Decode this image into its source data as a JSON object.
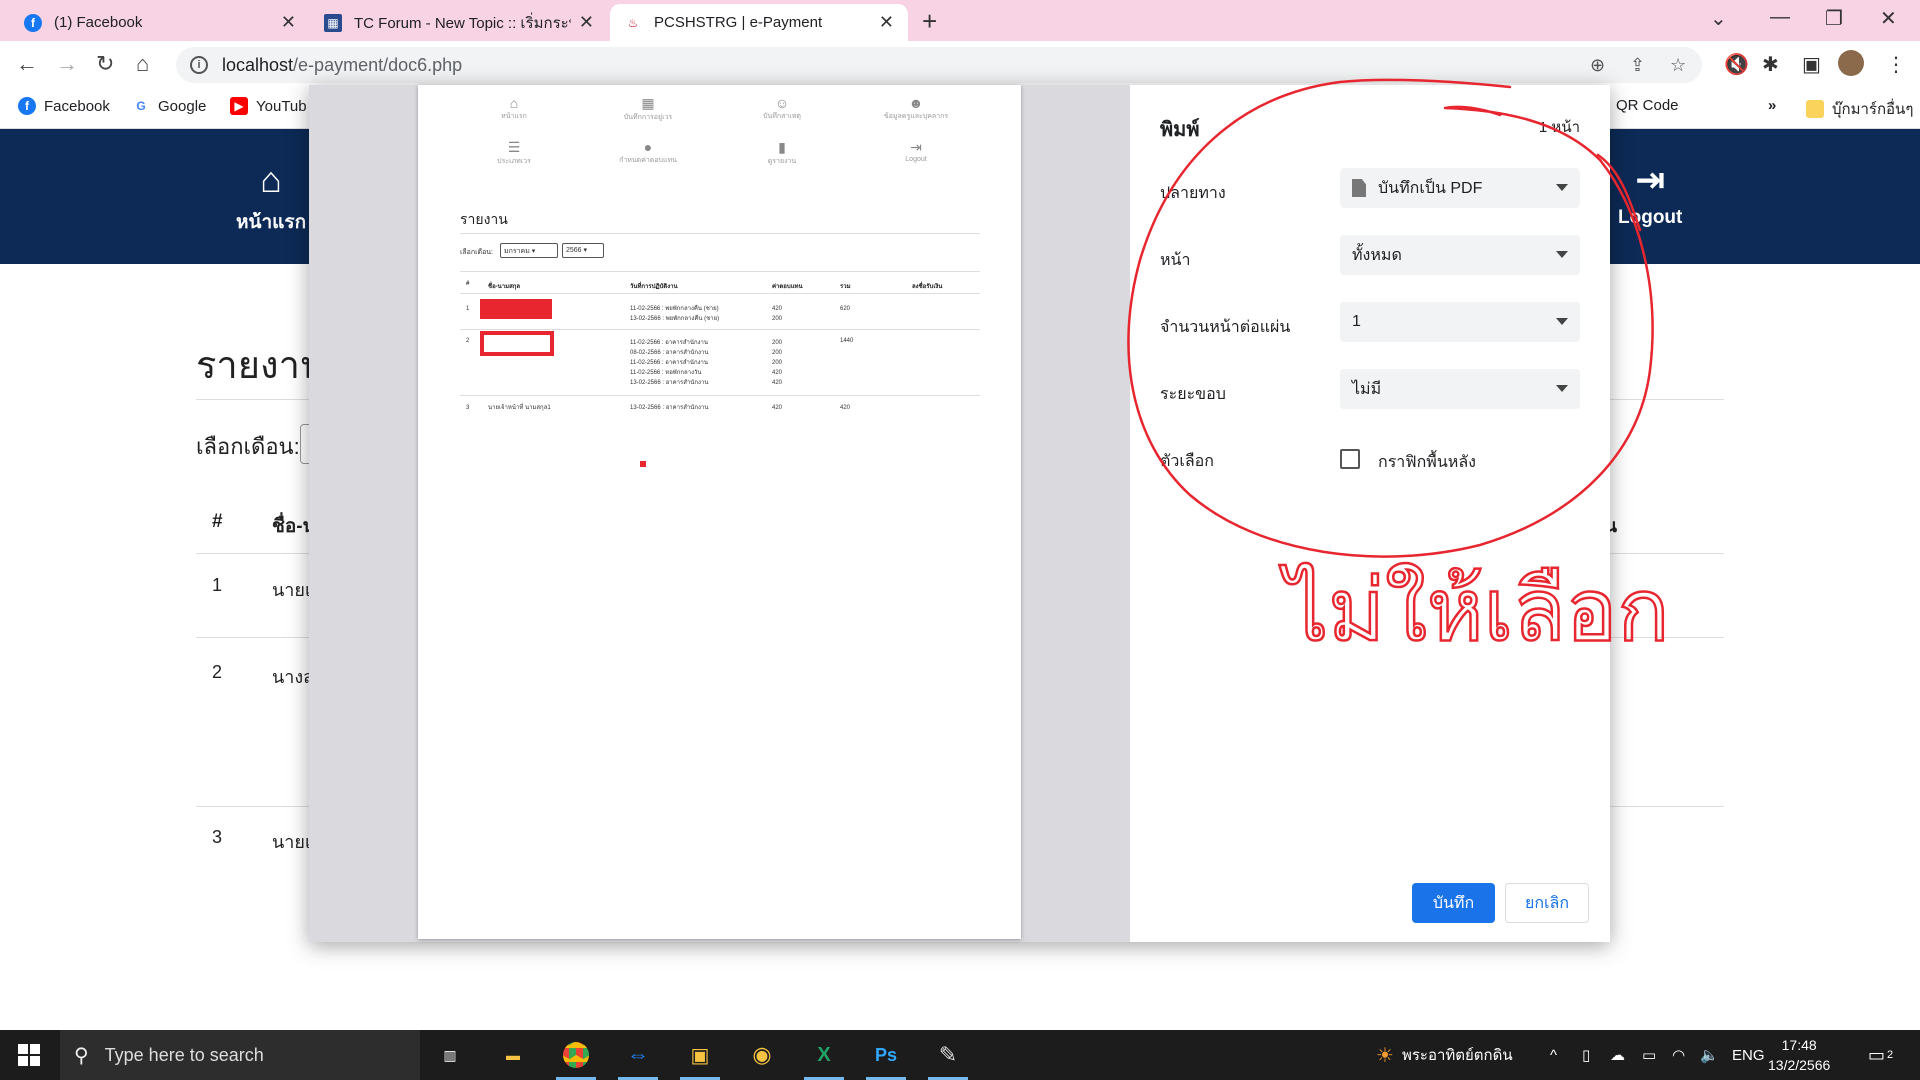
{
  "browser": {
    "tabs": [
      {
        "title": "(1) Facebook",
        "icon": "facebook-icon"
      },
      {
        "title": "TC Forum - New Topic :: เริ่มกระทู้ใหม่",
        "icon": "tc-forum-icon"
      },
      {
        "title": "PCSHSTRG | e-Payment",
        "icon": "school-icon"
      }
    ],
    "url_host": "localhost",
    "url_path": "/e-payment/doc6.php",
    "bookmarks": [
      {
        "label": "Facebook",
        "icon": "facebook-icon"
      },
      {
        "label": "Google",
        "icon": "google-icon"
      },
      {
        "label": "YouTub",
        "icon": "youtube-icon"
      },
      {
        "label": "QR Code",
        "icon": "qr-icon"
      },
      {
        "label": "บุ๊กมาร์กอื่นๆ",
        "icon": "folder-icon"
      }
    ],
    "bookmarks_more": "»"
  },
  "site": {
    "nav": [
      {
        "label": "หน้าแรก",
        "icon": "home-icon"
      },
      {
        "label": "Logout",
        "icon": "logout-icon"
      }
    ],
    "title": "รายงาน",
    "month_label": "เลือกเดือน:",
    "table_headers": [
      "#",
      "ชื่อ-น"
    ],
    "rows": [
      {
        "no": "1",
        "name": "นายเ"
      },
      {
        "no": "2",
        "name": "นางส"
      },
      {
        "no": "3",
        "name": "นายเ"
      }
    ],
    "right_header_fragment": "น"
  },
  "print_preview": {
    "nav": [
      "หน้าแรก",
      "บันทึกการอยู่เวร",
      "บันทึกสาเหตุ",
      "ข้อมูลครูและบุคลากร",
      "ประเภทเวร",
      "กำหนดค่าตอบแทน",
      "ดูรายงาน",
      "Logout"
    ],
    "title": "รายงาน",
    "month_label": "เลือกเดือน:",
    "month_value": "มกราคม",
    "year_value": "2566",
    "headers": [
      "#",
      "ชื่อ-นามสกุล",
      "วันที่การปฏิบัติงาน",
      "ค่าตอบแทน",
      "รวม",
      "ลงชื่อรับเงิน"
    ],
    "rows": [
      {
        "no": "1",
        "name": "",
        "dates": "11-02-2566 : พยพักกลางคืน (ชาย)\n13-02-2566 : พยพักกลางคืน (ชาย)",
        "pay": "420\n200",
        "total": "620"
      },
      {
        "no": "2",
        "name": "",
        "dates": "11-02-2566 : อาคารสำนักงาน\n08-02-2566 : อาคารสำนักงาน\n11-02-2566 : อาคารสำนักงาน\n11-02-2566 : หอพักกลางวัน\n13-02-2566 : อาคารสำนักงาน",
        "pay": "200\n200\n200\n420\n420",
        "total": "1440"
      },
      {
        "no": "3",
        "name": "นายเจ้าหน้าที่ นามสกุล1",
        "dates": "13-02-2566 : อาคารสำนักงาน",
        "pay": "420",
        "total": "420"
      }
    ]
  },
  "print_settings": {
    "title": "พิมพ์",
    "page_count": "1 หน้า",
    "destination_label": "ปลายทาง",
    "destination_value": "บันทึกเป็น PDF",
    "pages_label": "หน้า",
    "pages_value": "ทั้งหมด",
    "pages_per_sheet_label": "จำนวนหน้าต่อแผ่น",
    "pages_per_sheet_value": "1",
    "margins_label": "ระยะขอบ",
    "margins_value": "ไม่มี",
    "options_label": "ตัวเลือก",
    "background_graphics_label": "กราฟิกพื้นหลัง",
    "save_button": "บันทึก",
    "cancel_button": "ยกเลิก"
  },
  "annotation": {
    "handwritten_text": "ไม่ให้เลือก",
    "color": "#e8262f"
  },
  "taskbar": {
    "search_placeholder": "Type here to search",
    "apps": [
      "task-view-icon",
      "file-explorer-icon",
      "chrome-icon",
      "teamviewer-icon",
      "app-icon",
      "line-icon",
      "excel-icon",
      "photoshop-icon",
      "paint-icon"
    ],
    "weather_text": "พระอาทิตย์ตกดิน",
    "language": "ENG",
    "time": "17:48",
    "date": "13/2/2566",
    "notification_count": "2"
  }
}
